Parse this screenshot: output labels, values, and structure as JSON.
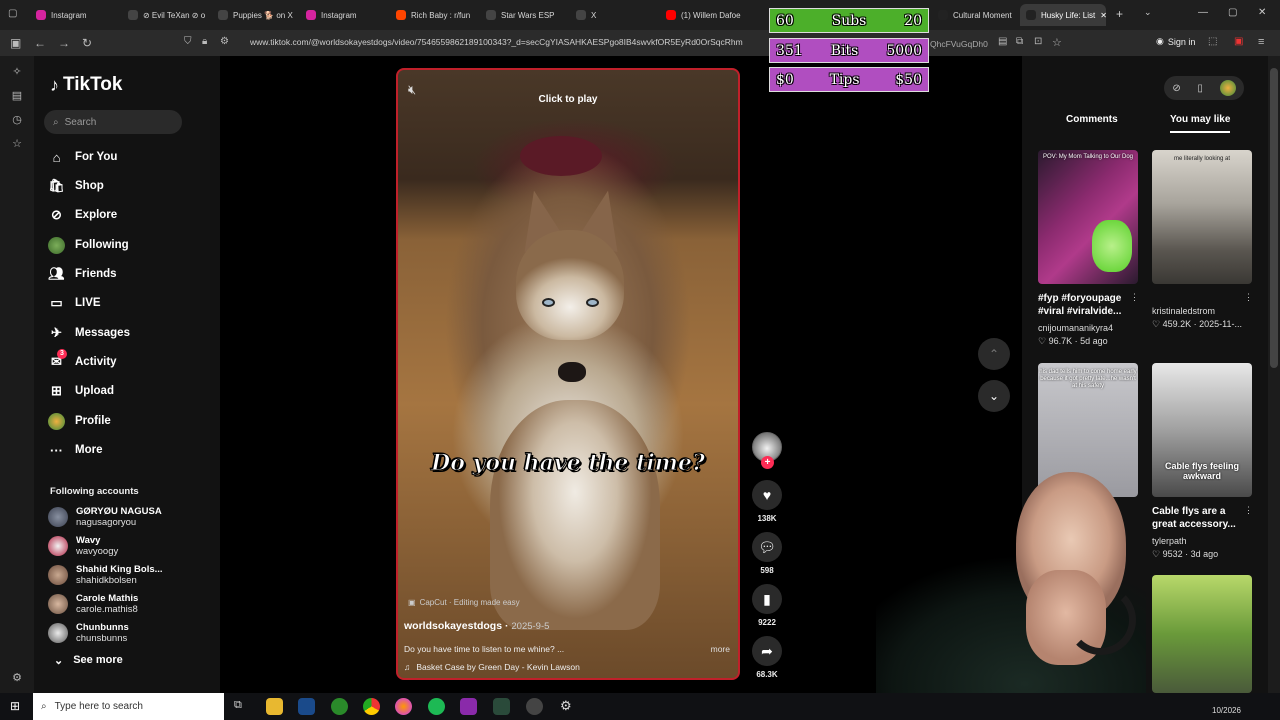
{
  "browser": {
    "tabs": [
      {
        "label": "Instagram",
        "color": "#d6249f"
      },
      {
        "label": "⊘ Evil TeXan ⊘ o",
        "color": "#000000"
      },
      {
        "label": "Puppies 🐕 on X",
        "color": "#000000"
      },
      {
        "label": "Instagram",
        "color": "#d6249f"
      },
      {
        "label": "Rich Baby : r/fun",
        "color": "#ff4500"
      },
      {
        "label": "Star Wars ESP",
        "color": "#000000"
      },
      {
        "label": "X",
        "color": "#000000"
      },
      {
        "label": "(1) Willem Dafoe",
        "color": "#ff0000"
      },
      {
        "label": "Cultural Moment",
        "color": "#000000"
      },
      {
        "label": "Husky Life: List",
        "color": "#000000"
      }
    ],
    "url": "www.tiktok.com/@worldsokayestdogs/video/7546559862189100343?_d=secCgYIASAHKAESPgo8IB4swvkfOR5EyRd0OrSqcRhm",
    "url_tail": "QhcFVuGqDh0",
    "signin_label": "Sign in"
  },
  "tiktok": {
    "brand": "TikTok",
    "search_placeholder": "Search",
    "nav": [
      {
        "label": "For You",
        "icon": "home-icon"
      },
      {
        "label": "Shop",
        "icon": "shop-icon"
      },
      {
        "label": "Explore",
        "icon": "compass-icon"
      },
      {
        "label": "Following",
        "icon": "following-avatar-icon"
      },
      {
        "label": "Friends",
        "icon": "friends-icon"
      },
      {
        "label": "LIVE",
        "icon": "live-icon"
      },
      {
        "label": "Messages",
        "icon": "messages-icon"
      },
      {
        "label": "Activity",
        "icon": "activity-icon",
        "badge": "3"
      },
      {
        "label": "Upload",
        "icon": "upload-icon"
      },
      {
        "label": "Profile",
        "icon": "profile-avatar-icon"
      },
      {
        "label": "More",
        "icon": "more-icon"
      }
    ],
    "following_title": "Following accounts",
    "accounts": [
      {
        "name": "GØRYØU NAGUSA",
        "handle": "nagusagoryou"
      },
      {
        "name": "Wavy",
        "handle": "wavyoogy"
      },
      {
        "name": "Shahid King Bols...",
        "handle": "shahidkbolsen"
      },
      {
        "name": "Carole Mathis",
        "handle": "carole.mathis8"
      },
      {
        "name": "Chunbunns",
        "handle": "chunsbunns"
      }
    ],
    "see_more": "See more"
  },
  "video": {
    "click_to_play": "Click to play",
    "caption": "Do you have the time?",
    "capcut": "CapCut · Editing made easy",
    "author": "worldsokayestdogs",
    "date": "2025-9-5",
    "description": "Do you have time to listen to me whine? ...",
    "more": "more",
    "music": "Basket Case by Green Day - Kevin Lawson",
    "likes": "138K",
    "comments": "598",
    "saves": "9222",
    "shares": "68.3K"
  },
  "right_panel": {
    "tab_comments": "Comments",
    "tab_you_may_like": "You may like",
    "items": [
      {
        "title": "#fyp #foryoupage #viral #viralvide...",
        "user": "cnijoumananikyra4",
        "stats": "96.7K · 5d ago",
        "thumb_text": "POV: My Mom Talking to Our Dog"
      },
      {
        "title": "",
        "user": "kristinaledstrom",
        "stats": "459.2K · 2025-11-...",
        "thumb_text": "me literally looking at"
      },
      {
        "title": "",
        "user": "",
        "stats": "",
        "thumb_text": "his dad tells him to come home early because it got pretty late...he wasn't at his safety"
      },
      {
        "title": "Cable flys are a great accessory...",
        "user": "tylerpath",
        "stats": "9532 · 3d ago",
        "thumb_text": "Cable flys feeling awkward"
      }
    ]
  },
  "overlay": [
    {
      "left": "60",
      "mid": "Subs",
      "right": "20",
      "color": "#4caf2a",
      "fill": 0.75
    },
    {
      "left": "351",
      "mid": "Bits",
      "right": "5000",
      "color": "#b04ec0",
      "fill": 0.07
    },
    {
      "left": "$0",
      "mid": "Tips",
      "right": "$50",
      "color": "#b04ec0",
      "fill": 0.0
    }
  ],
  "taskbar": {
    "search_placeholder": "Type here to search",
    "time": "10/2026"
  }
}
